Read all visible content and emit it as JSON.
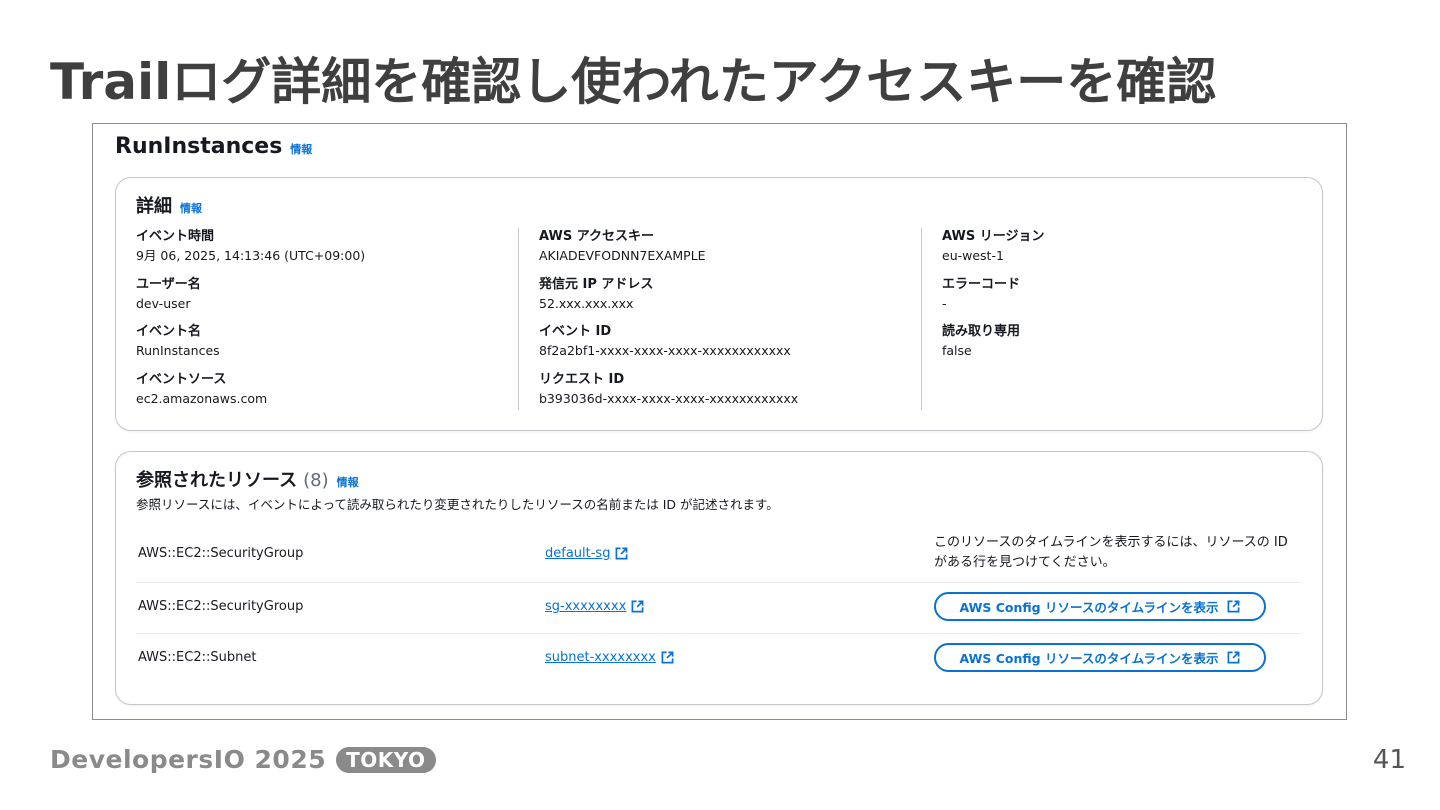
{
  "slide": {
    "title": "Trailログ詳細を確認し使われたアクセスキーを確認",
    "page_number": "41"
  },
  "footer": {
    "brand": "DevelopersIO 2025",
    "tag": "TOKYO"
  },
  "screenshot": {
    "heading": "RunInstances",
    "heading_info": "情報",
    "details": {
      "title": "詳細",
      "info": "情報",
      "columns": [
        [
          {
            "label": "イベント時間",
            "value": "9月 06, 2025, 14:13:46 (UTC+09:00)"
          },
          {
            "label": "ユーザー名",
            "value": "dev-user"
          },
          {
            "label": "イベント名",
            "value": "RunInstances"
          },
          {
            "label": "イベントソース",
            "value": "ec2.amazonaws.com"
          }
        ],
        [
          {
            "label": "AWS アクセスキー",
            "value": "AKIADEVFODNN7EXAMPLE"
          },
          {
            "label": "発信元 IP アドレス",
            "value": "52.xxx.xxx.xxx"
          },
          {
            "label": "イベント ID",
            "value": "8f2a2bf1-xxxx-xxxx-xxxx-xxxxxxxxxxxx"
          },
          {
            "label": "リクエスト ID",
            "value": "b393036d-xxxx-xxxx-xxxx-xxxxxxxxxxxx"
          }
        ],
        [
          {
            "label": "AWS リージョン",
            "value": "eu-west-1"
          },
          {
            "label": "エラーコード",
            "value": "-"
          },
          {
            "label": "読み取り専用",
            "value": "false"
          }
        ]
      ]
    },
    "resources": {
      "title": "参照されたリソース",
      "count": "(8)",
      "info": "情報",
      "description": "参照リソースには、イベントによって読み取られたり変更されたりしたリソースの名前または ID が記述されます。",
      "rows": [
        {
          "type": "AWS::EC2::SecurityGroup",
          "name": "default-sg",
          "note": "このリソースのタイムラインを表示するには、リソースの ID がある行を見つけてください。"
        },
        {
          "type": "AWS::EC2::SecurityGroup",
          "name": "sg-xxxxxxxx",
          "button": "AWS Config リソースのタイムラインを表示"
        },
        {
          "type": "AWS::EC2::Subnet",
          "name": "subnet-xxxxxxxx",
          "button": "AWS Config リソースのタイムラインを表示"
        }
      ]
    }
  },
  "colors": {
    "link": "#0972d3",
    "title": "#3f3f3f",
    "brand": "#8a8a8a"
  },
  "icons": [
    "external-link-icon"
  ]
}
